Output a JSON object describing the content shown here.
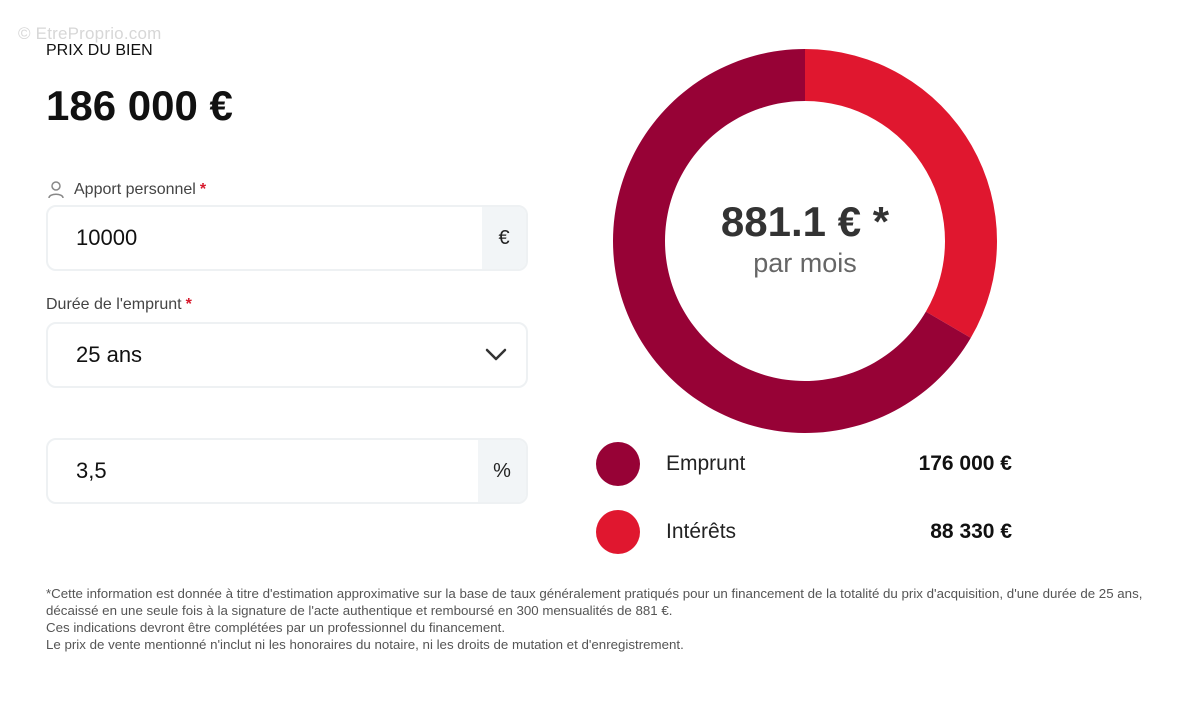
{
  "watermark": "© EtreProprio.com",
  "price": {
    "label": "PRIX DU BIEN",
    "value": "186 000 €"
  },
  "apport": {
    "label": "Apport personnel",
    "required": "*",
    "value": "10000",
    "suffix": "€"
  },
  "duree": {
    "label": "Durée de l'emprunt",
    "required": "*",
    "value": "25 ans"
  },
  "taux": {
    "value": "3,5",
    "suffix": "%"
  },
  "monthly": {
    "amount": "881.1 € *",
    "unit": "par mois"
  },
  "legend": [
    {
      "name": "Emprunt",
      "value": "176 000 €",
      "color": "#970236"
    },
    {
      "name": "Intérêts",
      "value": "88 330 €",
      "color": "#e0172f"
    }
  ],
  "chart_data": {
    "type": "pie",
    "series": [
      {
        "name": "Emprunt",
        "value": 176000,
        "color": "#970236"
      },
      {
        "name": "Intérêts",
        "value": 88330,
        "color": "#e0172f"
      }
    ]
  },
  "disclaimer": [
    "*Cette information est donnée à titre d'estimation approximative sur la base de taux généralement pratiqués pour un financement de la totalité du prix d'acquisition, d'une durée de 25 ans, décaissé en une seule fois à la signature de l'acte authentique et remboursé en 300 mensualités de 881 €.",
    "Ces indications devront être complétées par un professionnel du financement.",
    "Le prix de vente mentionné n'inclut ni les honoraires du notaire, ni les droits de mutation et d'enregistrement."
  ],
  "icons": {
    "user": "user-icon",
    "chevron": "chevron-down-icon"
  }
}
